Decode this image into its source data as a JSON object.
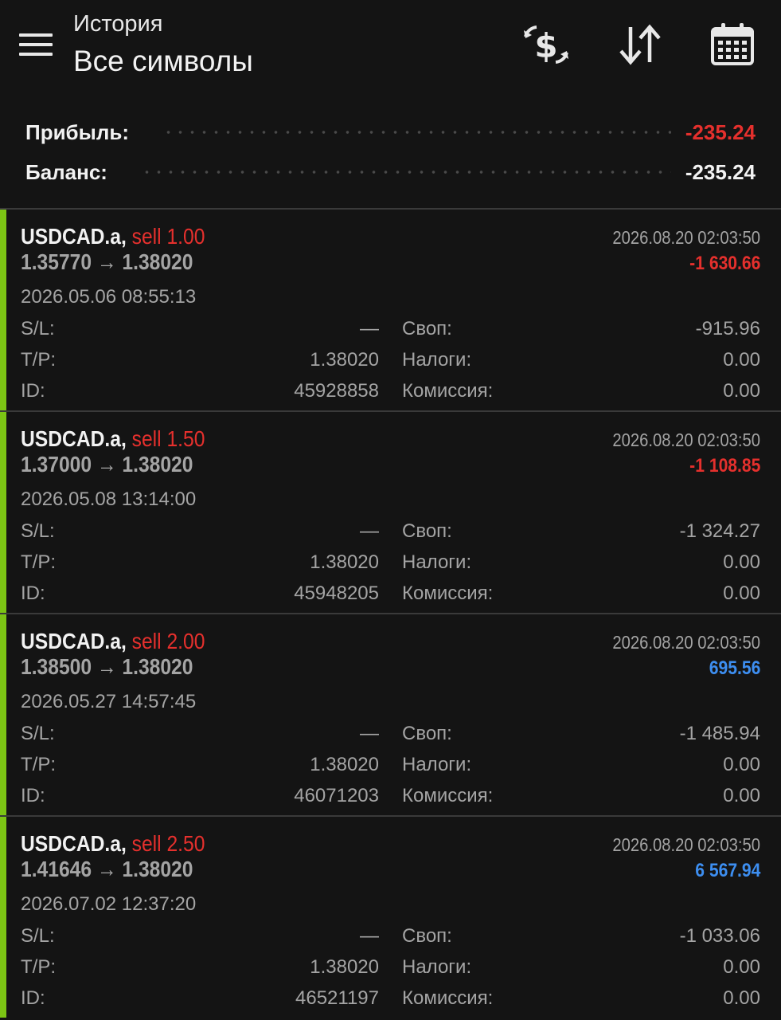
{
  "header": {
    "title_small": "История",
    "title_big": "Все символы",
    "icons": [
      "menu-icon",
      "currency-exchange-icon",
      "sort-icon",
      "calendar-icon"
    ]
  },
  "summary": {
    "profit_label": "Прибыль:",
    "profit_value": "-235.24",
    "balance_label": "Баланс:",
    "balance_value": "-235.24"
  },
  "labels": {
    "sl": "S/L:",
    "tp": "T/P:",
    "id": "ID:",
    "swap": "Своп:",
    "taxes": "Налоги:",
    "commission": "Комиссия:"
  },
  "colors": {
    "negative": "#e5302d",
    "positive": "#3d8ef0",
    "accent_bar": "#7cc514",
    "background": "#141414"
  },
  "deals": [
    {
      "symbol": "USDCAD.a,",
      "type": "sell 1.00",
      "prices": "1.35770 → 1.38020",
      "close_time": "2026.08.20 02:03:50",
      "profit": "-1 630.66",
      "open_time": "2026.05.06 08:55:13",
      "sl": "—",
      "tp": "1.38020",
      "id": "45928858",
      "swap": "-915.96",
      "taxes": "0.00",
      "commission": "0.00"
    },
    {
      "symbol": "USDCAD.a,",
      "type": "sell 1.50",
      "prices": "1.37000 → 1.38020",
      "close_time": "2026.08.20 02:03:50",
      "profit": "-1 108.85",
      "open_time": "2026.05.08 13:14:00",
      "sl": "—",
      "tp": "1.38020",
      "id": "45948205",
      "swap": "-1 324.27",
      "taxes": "0.00",
      "commission": "0.00"
    },
    {
      "symbol": "USDCAD.a,",
      "type": "sell 2.00",
      "prices": "1.38500 → 1.38020",
      "close_time": "2026.08.20 02:03:50",
      "profit": "695.56",
      "open_time": "2026.05.27 14:57:45",
      "sl": "—",
      "tp": "1.38020",
      "id": "46071203",
      "swap": "-1 485.94",
      "taxes": "0.00",
      "commission": "0.00"
    },
    {
      "symbol": "USDCAD.a,",
      "type": "sell 2.50",
      "prices": "1.41646 → 1.38020",
      "close_time": "2026.08.20 02:03:50",
      "profit": "6 567.94",
      "open_time": "2026.07.02 12:37:20",
      "sl": "—",
      "tp": "1.38020",
      "id": "46521197",
      "swap": "-1 033.06",
      "taxes": "0.00",
      "commission": "0.00"
    }
  ]
}
